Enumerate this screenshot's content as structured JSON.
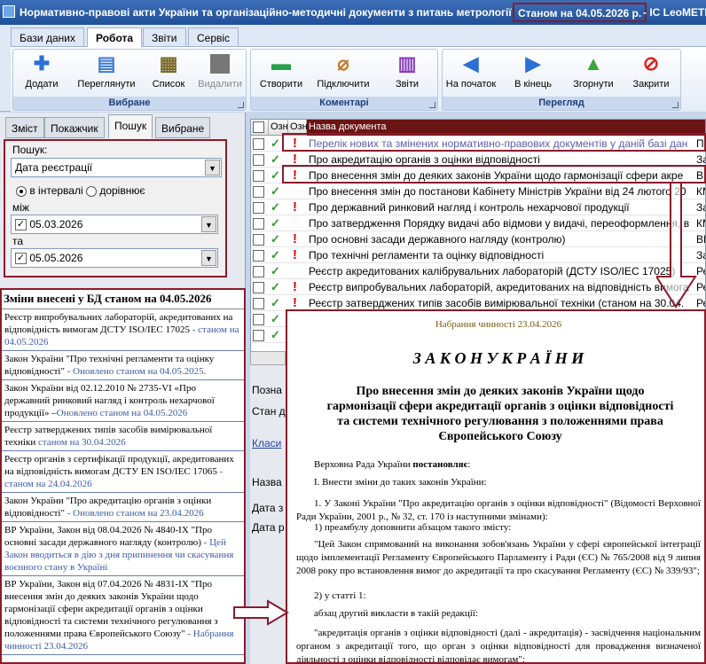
{
  "window": {
    "title_main": "Нормативно-правові акти України та організаційно-методичні документи з питань метрології",
    "title_status": "Станом на 04.05.2026 р.",
    "title_suffix": "- ІС LeoMETR"
  },
  "ribbon": {
    "tabs": [
      "Бази даних",
      "Робота",
      "Звіти",
      "Сервіс"
    ],
    "active_tab": "Робота",
    "groups": [
      {
        "label": "Вибране",
        "buttons": [
          {
            "label": "Додати",
            "icon": "plus-icon"
          },
          {
            "label": "Переглянути",
            "icon": "view-icon"
          },
          {
            "label": "Список",
            "icon": "list-icon"
          },
          {
            "label": "Видалити",
            "icon": "delete-icon"
          }
        ]
      },
      {
        "label": "Коментарі",
        "buttons": [
          {
            "label": "Створити",
            "icon": "comment-icon"
          },
          {
            "label": "Підключити",
            "icon": "paperclip-icon"
          },
          {
            "label": "Звіти",
            "icon": "chart-icon"
          }
        ]
      },
      {
        "label": "Перегляд",
        "buttons": [
          {
            "label": "На початок",
            "icon": "arrow-left-icon"
          },
          {
            "label": "В кінець",
            "icon": "arrow-right-icon"
          },
          {
            "label": "Згорнути",
            "icon": "arrow-up-icon"
          },
          {
            "label": "Закрити",
            "icon": "stop-icon"
          }
        ]
      }
    ]
  },
  "left_tabs": [
    "Зміст",
    "Покажчик",
    "Пошук",
    "Вибране"
  ],
  "left_active_tab": "Пошук",
  "search": {
    "label": "Пошук:",
    "field": "Дата реєстрації",
    "radio_interval": "в інтервалі",
    "radio_equal": "дорівнює",
    "between_label": "між",
    "date_from": "05.03.2026",
    "and_label": "та",
    "date_to": "05.05.2026"
  },
  "news": {
    "heading": "Зміни внесені у БД станом на 04.05.2026",
    "items": [
      {
        "text": "Реєстр випробувальних лабораторій, акредитованих на відповідність вимогам ДСТУ ISO/IEC 17025",
        "suffix": " - станом на 04.05.2026"
      },
      {
        "text": "Закон України \"Про технічні регламенти та оцінку відповідності\"",
        "suffix": " - Оновлено станом на 04.05.2025."
      },
      {
        "text": "Закон України від 02.12.2010 № 2735-VI «Про державний ринковий нагляд і контроль нехарчової продукції» –",
        "suffix": "Оновлено станом на 04.05.2026"
      },
      {
        "text": "Реєстр затверджених типів засобів вимірювальної техніки",
        "suffix": " станом на 30.04.2026"
      },
      {
        "text": "Реєстр органів з сертифікації продукції, акредитованих на відповідність вимогам ДСТУ EN ISO/IEC 17065",
        "suffix": " - станом на 24.04.2026"
      },
      {
        "text": "Закон України \"Про акредитацію органів з оцінки відповідності\"",
        "suffix": " - Оновлено станом на 23.04.2026"
      },
      {
        "text": "ВР України, Закон від 08.04.2026 № 4840-IX \"Про основні засади державного нагляду (контролю)",
        "suffix": " - Цей Закон вводиться в дію з дня припинення чи скасування воєнного стану в Україні"
      },
      {
        "text": "ВР України, Закон від 07.04.2026 № 4831-IX \"Про внесення змін до деяких законів України щодо гармонізації сфери акредитації органів з оцінки відповідності та системи технічного регулювання з положеннями права Європейського Союзу\"",
        "suffix": " - Набрання чинності 23.04.2026"
      }
    ]
  },
  "grid": {
    "col_ozn1": "Озн",
    "col_ozn2": "Озн",
    "col_name": "Назва документа",
    "rows": [
      {
        "name": "Перелік нових та змінених нормативно-правових документів у даній базі дан",
        "tail": "Пе"
      },
      {
        "name": "Про акредитацію органів з оцінки відповідності",
        "tail": "За"
      },
      {
        "name": "Про внесення змін до деяких законів України щодо гармонізації сфери акре",
        "tail": "ВР"
      },
      {
        "name": "Про внесення змін до постанови Кабінету Міністрів України від 24 лютого 20",
        "tail": "КМ"
      },
      {
        "name": "Про державний ринковий нагляд і контроль нехарчової продукції",
        "tail": "За"
      },
      {
        "name": "Про затвердження Порядку видачі або відмови у видачі, переоформлення, в",
        "tail": "КМ"
      },
      {
        "name": "Про основні засади державного нагляду (контролю)",
        "tail": "ВР"
      },
      {
        "name": "Про технічні регламенти та оцінку відповідності",
        "tail": "За"
      },
      {
        "name": "Реєстр акредитованих калібрувальних лабораторій (ДСТУ ISO/IEC 17025)",
        "tail": "Ре"
      },
      {
        "name": "Реєстр випробувальних лабораторій, акредитованих на відповідність вимога",
        "tail": "Ре"
      },
      {
        "name": "Реєстр затверджених типів засобів вимірювальної техніки  (станом на 30.04.",
        "tail": "Ре"
      }
    ]
  },
  "below_grid": [
    "Позна",
    "Стан д",
    "Класи",
    "Назва",
    "Дата з",
    "Дата р"
  ],
  "document": {
    "effective": "Набрання чинності 23.04.2026",
    "law_title": "З А К О Н   У К Р А Ї Н И",
    "subject": "Про внесення змін до деяких законів України щодо гармонізації сфери акредитації органів з оцінки відповідності та системи технічного регулювання з положеннями права Європейського Союзу",
    "p1_a": "Верховна Рада України ",
    "p1_b": "постановляє",
    "p1_c": ":",
    "p2": "І. Внести зміни до таких законів України:",
    "p3": "1. У Законі України \"Про акредитацію органів з оцінки відповідності\" (Відомості Верховної Ради України, 2001 р., № 32, ст. 170 із наступними змінами):",
    "p4": "1) преамбулу доповнити абзацом такого змісту:",
    "p5": "\"Цей Закон спрямований на виконання зобов'язань України у сфері європейської інтеграції щодо імплементації Регламенту Європейського Парламенту і Ради (ЄС) № 765/2008 від 9 липня 2008 року про встановлення вимог до акредитації та про скасування Регламенту (ЄС) № 339/93\";",
    "p6": "2) у статті 1:",
    "p7": "абзац другий викласти в такій редакції:",
    "p8": "\"акредитація органів з оцінки відповідності (далі - акредитація) - засвідчення національним органом з акредитації того, що орган з оцінки відповідності для провадження визначеної діяльності з оцінки відповідності відповідає вимогам\";"
  }
}
